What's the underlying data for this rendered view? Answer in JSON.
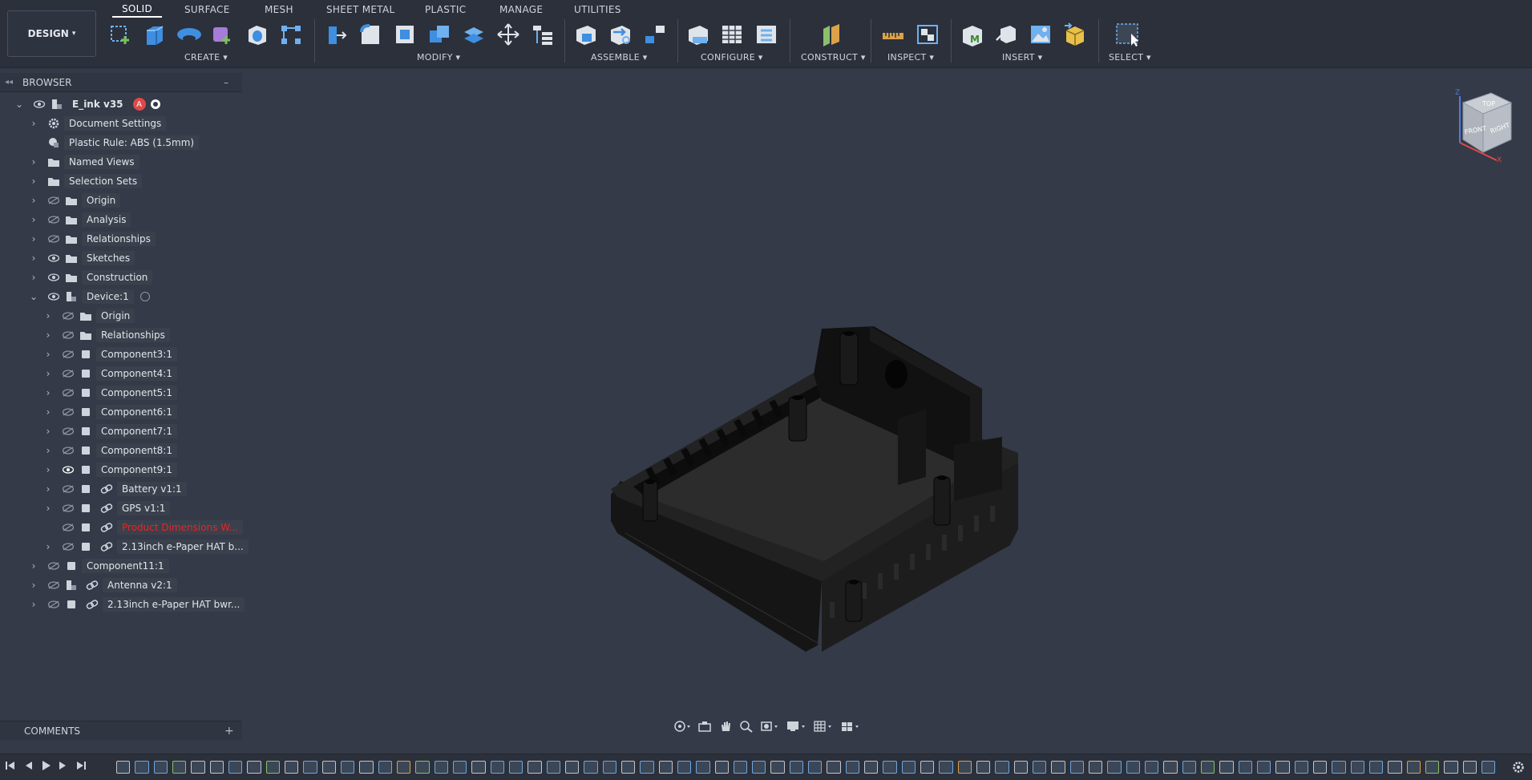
{
  "toolbar": {
    "workspace": "DESIGN",
    "tabs": [
      "SOLID",
      "SURFACE",
      "MESH",
      "SHEET METAL",
      "PLASTIC",
      "MANAGE",
      "UTILITIES"
    ],
    "active_tab": "SOLID",
    "groups": [
      "CREATE",
      "MODIFY",
      "ASSEMBLE",
      "CONFIGURE",
      "CONSTRUCT",
      "INSPECT",
      "INSERT",
      "SELECT"
    ],
    "accent": "#4f9ded"
  },
  "browser": {
    "title": "BROWSER",
    "collapse": "–",
    "items": [
      {
        "label": "E_ink v35",
        "icon": "component-icon"
      },
      {
        "label": "Document Settings",
        "icon": "gear-icon"
      },
      {
        "label": "Plastic Rule: ABS (1.5mm)",
        "icon": "plastic-rule-icon"
      },
      {
        "label": "Named Views",
        "icon": "folder-icon"
      },
      {
        "label": "Selection Sets",
        "icon": "folder-icon"
      },
      {
        "label": "Origin",
        "icon": "folder-icon"
      },
      {
        "label": "Analysis",
        "icon": "folder-icon"
      },
      {
        "label": "Relationships",
        "icon": "folder-icon"
      },
      {
        "label": "Sketches",
        "icon": "folder-icon"
      },
      {
        "label": "Construction",
        "icon": "folder-icon"
      },
      {
        "label": "Device:1",
        "icon": "component-icon"
      },
      {
        "label": "Origin",
        "icon": "folder-icon"
      },
      {
        "label": "Relationships",
        "icon": "folder-icon"
      },
      {
        "label": "Component3:1",
        "icon": "body-icon"
      },
      {
        "label": "Component4:1",
        "icon": "body-icon"
      },
      {
        "label": "Component5:1",
        "icon": "body-icon"
      },
      {
        "label": "Component6:1",
        "icon": "body-icon"
      },
      {
        "label": "Component7:1",
        "icon": "body-icon"
      },
      {
        "label": "Component8:1",
        "icon": "body-icon"
      },
      {
        "label": "Component9:1",
        "icon": "body-icon"
      },
      {
        "label": "Battery v1:1",
        "icon": "link-icon"
      },
      {
        "label": "GPS v1:1",
        "icon": "link-icon"
      },
      {
        "label": "Product Dimensions W...",
        "icon": "link-icon"
      },
      {
        "label": "2.13inch e-Paper HAT b...",
        "icon": "link-icon"
      },
      {
        "label": "Component11:1",
        "icon": "body-icon"
      },
      {
        "label": "Antenna v2:1",
        "icon": "link-icon"
      },
      {
        "label": "2.13inch e-Paper HAT bwr...",
        "icon": "link-icon"
      }
    ]
  },
  "comments": {
    "title": "COMMENTS",
    "add": "+"
  },
  "viewcube": {
    "top": "TOP",
    "front": "FRONT",
    "right": "RIGHT",
    "z": "Z",
    "x": "X"
  }
}
